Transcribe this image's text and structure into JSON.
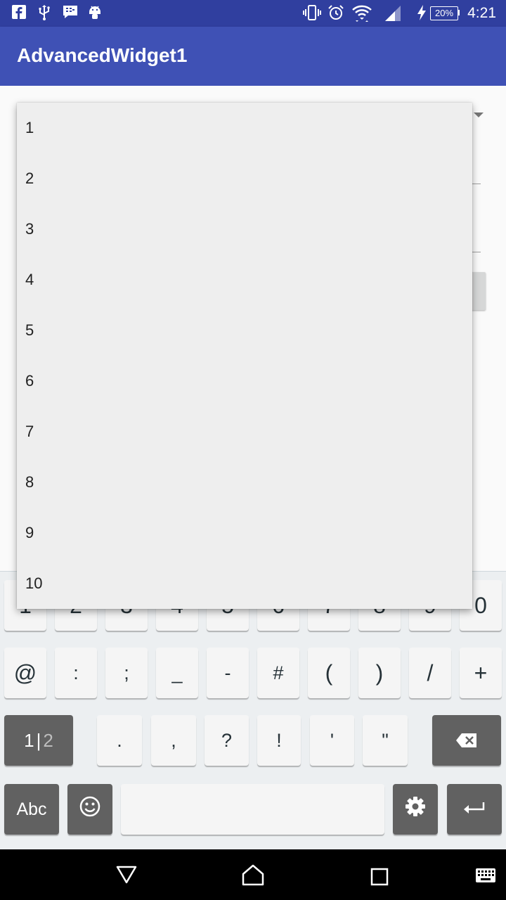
{
  "status_bar": {
    "time": "4:21",
    "battery": "20%",
    "icons": [
      "facebook-icon",
      "usb-icon",
      "bbm-icon",
      "android-icon",
      "vibrate-icon",
      "alarm-icon",
      "wifi-icon",
      "signal-icon",
      "charging-icon"
    ]
  },
  "app_bar": {
    "title": "AdvancedWidget1"
  },
  "dropdown": {
    "items": [
      "1",
      "2",
      "3",
      "4",
      "5",
      "6",
      "7",
      "8",
      "9",
      "10"
    ]
  },
  "keyboard": {
    "row1": [
      "1",
      "2",
      "3",
      "4",
      "5",
      "6",
      "7",
      "8",
      "9",
      "0"
    ],
    "row2": [
      "@",
      ":",
      ";",
      "_",
      "-",
      "#",
      "(",
      ")",
      "/",
      "+"
    ],
    "row3": [
      ".",
      ",",
      "?",
      "!",
      "'",
      "\""
    ],
    "page_switch_main": "1",
    "page_switch_sep": "|",
    "page_switch_alt": "2",
    "abc_label": "Abc"
  },
  "colors": {
    "primary": "#3f51b5",
    "primary_dark": "#303f9f",
    "dropdown_bg": "#eeeeee",
    "key_dark": "#616161"
  }
}
